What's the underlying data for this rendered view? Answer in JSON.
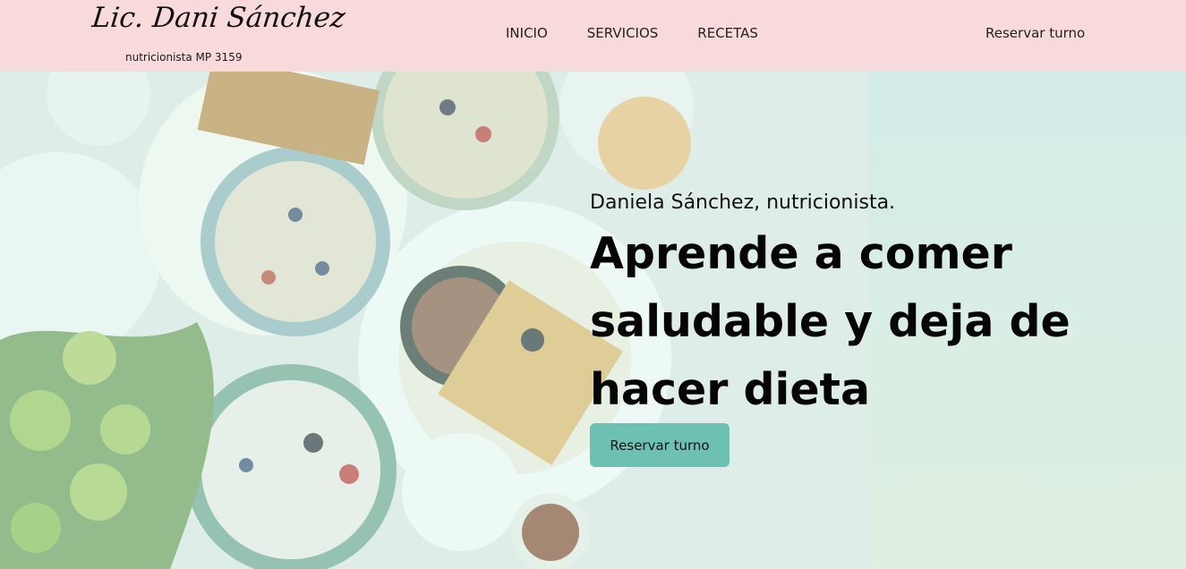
{
  "brand": {
    "logo_script": "Lic. Dani Sánchez",
    "subtitle": "nutricionista MP 3159"
  },
  "nav": {
    "links": [
      "INICIO",
      "SERVICIOS",
      "RECETAS"
    ],
    "cta": "Reservar turno"
  },
  "hero": {
    "subtitle": "Daniela Sánchez, nutricionista.",
    "title": "Aprende a comer saludable y deja de hacer dieta",
    "button": "Reservar turno"
  },
  "colors": {
    "navbar": "#f9dada",
    "accent": "#6dc1b3",
    "hero_bg": "#dcefe9"
  },
  "icons": {
    "logo": "script-signature-logo"
  }
}
